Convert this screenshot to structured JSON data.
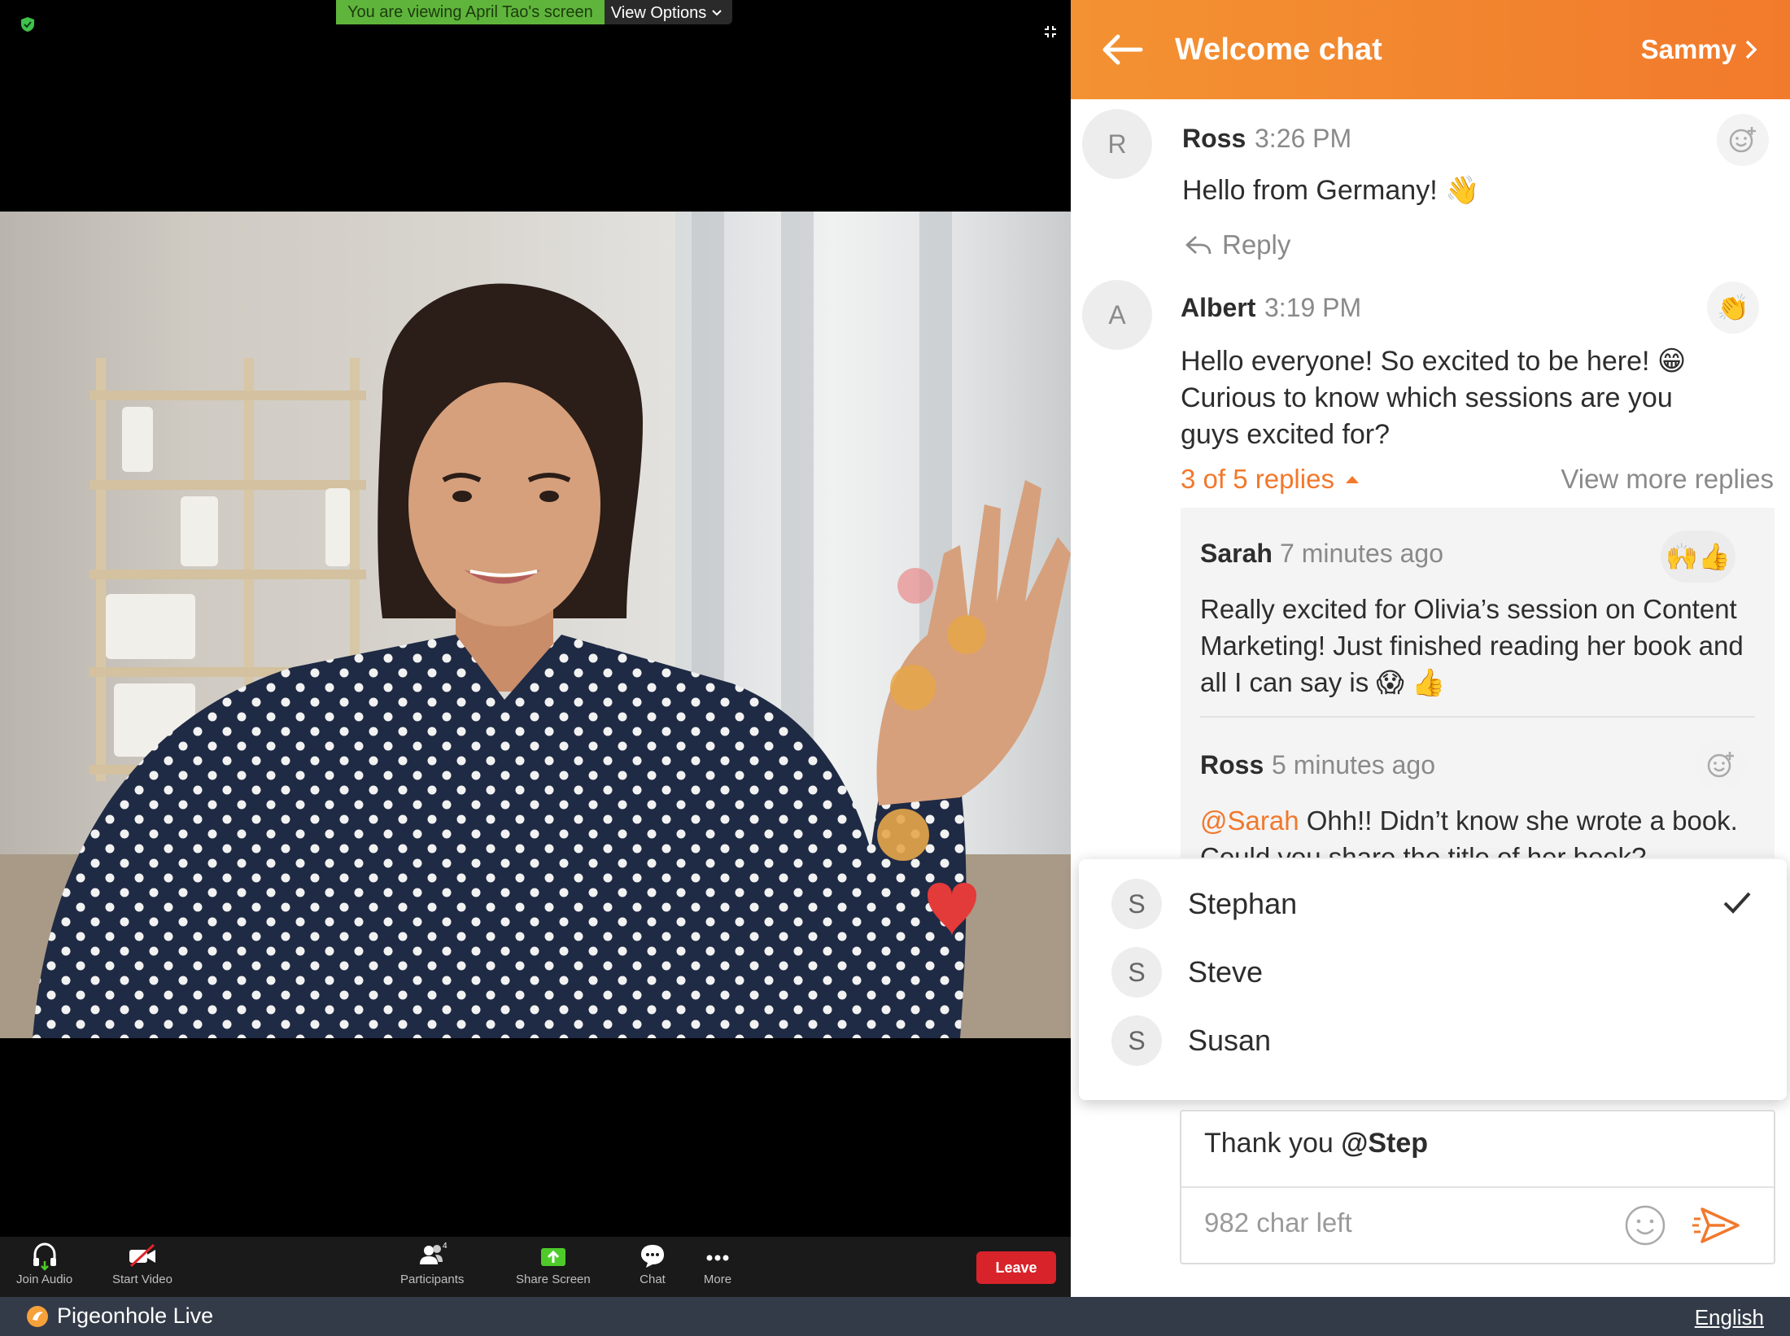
{
  "meeting": {
    "viewing_text": "You are viewing April Tao's screen",
    "view_options_label": "View Options",
    "reactions": [
      "😛",
      "❤️",
      "👏"
    ],
    "toolbar": {
      "join_audio": "Join Audio",
      "start_video": "Start Video",
      "participants": "Participants",
      "participants_count": "4",
      "share_screen": "Share Screen",
      "chat": "Chat",
      "more": "More",
      "leave": "Leave"
    },
    "colors": {
      "share_green": "#4ecb2b",
      "leave_red": "#d8232a",
      "banner_green": "#5fb53b"
    }
  },
  "chat": {
    "title": "Welcome chat",
    "user_link": "Sammy",
    "messages": [
      {
        "avatar": "R",
        "name": "Ross",
        "time": "3:26 PM",
        "text": "Hello from Germany! 👋",
        "reply_label": "Reply",
        "reaction_icon": "add-reaction-icon"
      },
      {
        "avatar": "A",
        "name": "Albert",
        "time": "3:19 PM",
        "text_lines": [
          "Hello everyone! So excited to be here! 😁",
          "Curious to know which sessions are you",
          "guys excited for?"
        ],
        "reaction": "👏",
        "replies_label": "3 of 5 replies",
        "view_more_label": "View more replies"
      }
    ],
    "thread": [
      {
        "name": "Sarah",
        "time": "7 minutes ago",
        "reaction": "🙌👍",
        "text_lines": [
          "Really excited for Olivia’s session on Content",
          "Marketing! Just finished reading her book and",
          "all I can say is 😱 👍"
        ]
      },
      {
        "name": "Ross",
        "time": "5 minutes ago",
        "mention": "@Sarah",
        "text_line_1": " Ohh!! Didn’t know she wrote a book.",
        "text_line_2": "Could you share the title of her book?"
      }
    ],
    "mention_suggestions": [
      {
        "initial": "S",
        "name": "Stephan",
        "selected": true
      },
      {
        "initial": "S",
        "name": "Steve",
        "selected": false
      },
      {
        "initial": "S",
        "name": "Susan",
        "selected": false
      }
    ],
    "composer": {
      "text_prefix": "Thank you ",
      "text_mention": "@Step",
      "char_left": "982 char left"
    },
    "colors": {
      "accent_orange": "#f2782c",
      "header_start": "#f39232"
    }
  },
  "footer": {
    "brand": "Pigeonhole Live",
    "language": "English"
  }
}
